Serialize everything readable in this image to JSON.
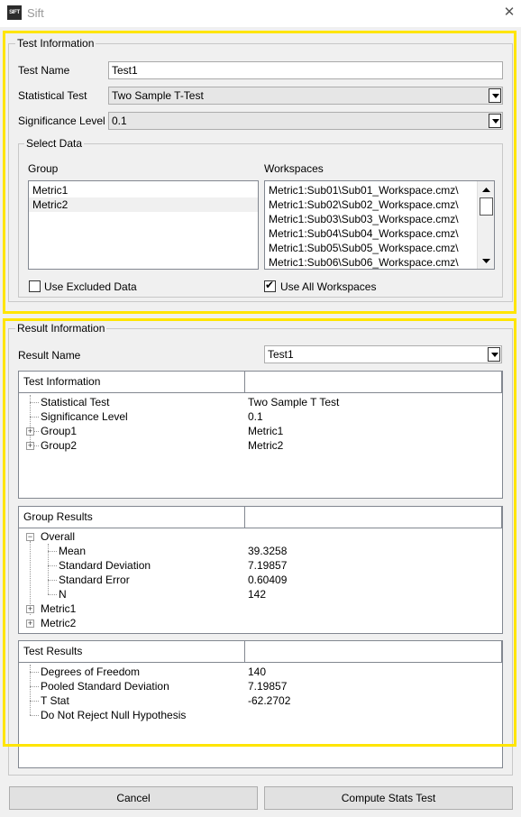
{
  "window": {
    "app_icon_text": "SIFT",
    "title": "Sift",
    "close_glyph": "✕"
  },
  "test_info": {
    "legend": "Test Information",
    "test_name_label": "Test Name",
    "test_name_value": "Test1",
    "stat_test_label": "Statistical Test",
    "stat_test_value": "Two Sample T-Test",
    "sig_level_label": "Significance Level",
    "sig_level_value": "0.1",
    "select_data": {
      "legend": "Select Data",
      "group_header": "Group",
      "workspaces_header": "Workspaces",
      "groups": [
        "Metric1",
        "Metric2"
      ],
      "workspaces": [
        "Metric1:Sub01\\Sub01_Workspace.cmz\\",
        "Metric1:Sub02\\Sub02_Workspace.cmz\\",
        "Metric1:Sub03\\Sub03_Workspace.cmz\\",
        "Metric1:Sub04\\Sub04_Workspace.cmz\\",
        "Metric1:Sub05\\Sub05_Workspace.cmz\\",
        "Metric1:Sub06\\Sub06_Workspace.cmz\\"
      ],
      "use_excluded_label": "Use Excluded Data",
      "use_excluded_checked": false,
      "use_all_label": "Use All Workspaces",
      "use_all_checked": true
    }
  },
  "result_info": {
    "legend": "Result Information",
    "result_name_label": "Result Name",
    "result_name_value": "Test1",
    "test_info_tree": {
      "header": "Test Information",
      "rows": [
        {
          "label": "Statistical Test",
          "value": "Two Sample T Test",
          "expander": ""
        },
        {
          "label": "Significance Level",
          "value": "0.1",
          "expander": ""
        },
        {
          "label": "Group1",
          "value": "Metric1",
          "expander": "+"
        },
        {
          "label": "Group2",
          "value": "Metric2",
          "expander": "+"
        }
      ]
    },
    "group_results_tree": {
      "header": "Group Results",
      "overall_label": "Overall",
      "overall_expander": "−",
      "overall_rows": [
        {
          "label": "Mean",
          "value": "39.3258"
        },
        {
          "label": "Standard Deviation",
          "value": "7.19857"
        },
        {
          "label": "Standard Error",
          "value": "0.60409"
        },
        {
          "label": "N",
          "value": "142"
        }
      ],
      "other_rows": [
        {
          "label": "Metric1",
          "expander": "+"
        },
        {
          "label": "Metric2",
          "expander": "+"
        }
      ]
    },
    "test_results_tree": {
      "header": "Test Results",
      "rows": [
        {
          "label": "Degrees of Freedom",
          "value": "140"
        },
        {
          "label": "Pooled Standard Deviation",
          "value": "7.19857"
        },
        {
          "label": "T Stat",
          "value": "-62.2702"
        },
        {
          "label": "Do Not Reject Null Hypothesis",
          "value": ""
        }
      ]
    }
  },
  "buttons": {
    "cancel": "Cancel",
    "compute": "Compute Stats Test"
  },
  "colors": {
    "highlight": "#ffe500",
    "window_bg": "#f0f0f0"
  }
}
